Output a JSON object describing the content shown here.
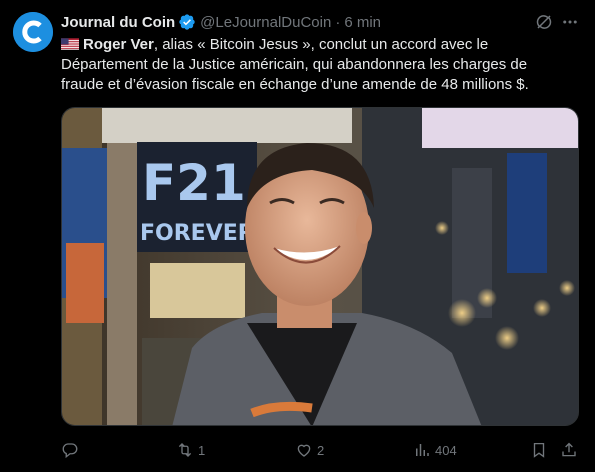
{
  "author": {
    "name": "Journal du Coin",
    "handle": "@LeJournalDuCoin",
    "separator": "·",
    "time": "6 min",
    "avatar_letter": "C",
    "avatar_color": "#1d8fe0",
    "verified_color": "#1d9bf0"
  },
  "tweet": {
    "flag": "us-flag",
    "bold_name": "Roger Ver",
    "text": ", alias « Bitcoin Jesus », conclut un accord avec le Département de la Justice américain, qui abandonnera les charges de fraude et d’évasion fiscale en échange d’une amende de 48 millions $."
  },
  "media": {
    "sign_line1": "F21",
    "sign_line2": "FOREVER 21"
  },
  "actions": {
    "replies": "",
    "retweets": "1",
    "likes": "2",
    "views": "404"
  },
  "colors": {
    "background": "#000000",
    "text": "#e7e9ea",
    "muted": "#71767b"
  }
}
